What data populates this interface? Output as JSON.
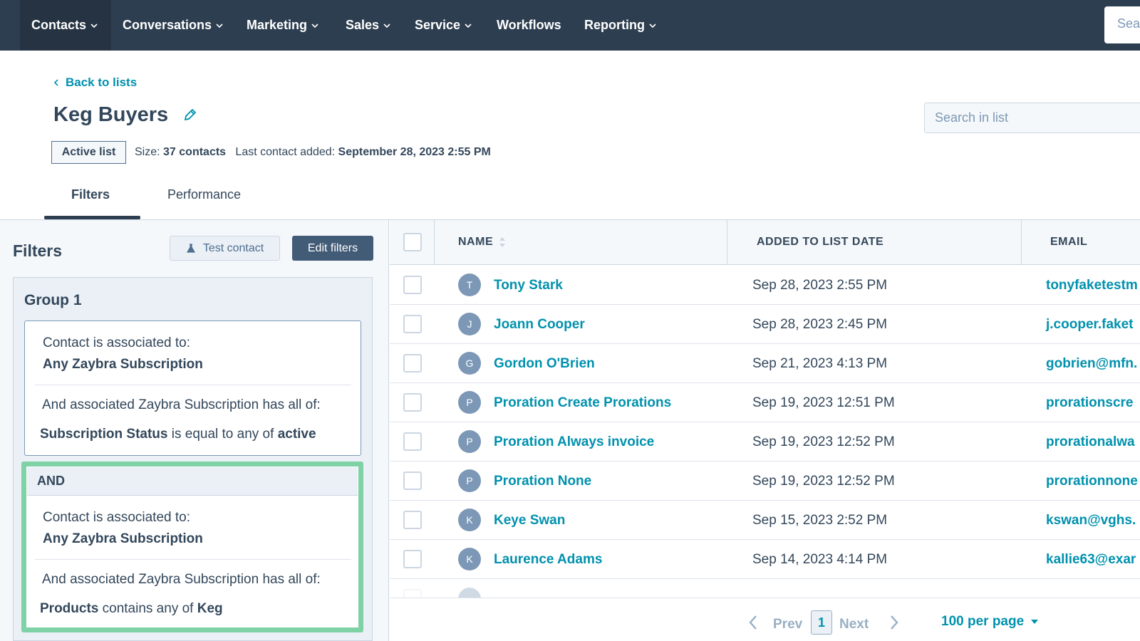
{
  "nav": {
    "items": [
      {
        "label": "Contacts",
        "has_dropdown": true,
        "active": true
      },
      {
        "label": "Conversations",
        "has_dropdown": true
      },
      {
        "label": "Marketing",
        "has_dropdown": true
      },
      {
        "label": "Sales",
        "has_dropdown": true
      },
      {
        "label": "Service",
        "has_dropdown": true
      },
      {
        "label": "Workflows",
        "has_dropdown": false
      },
      {
        "label": "Reporting",
        "has_dropdown": true
      }
    ],
    "search_placeholder": "Sea"
  },
  "header": {
    "back_label": "Back to lists",
    "title": "Keg Buyers",
    "badge": "Active list",
    "size_prefix": "Size:",
    "size_value": "37 contacts",
    "last_added_prefix": "Last contact added:",
    "last_added_value": "September 28, 2023 2:55 PM",
    "search_placeholder": "Search in list"
  },
  "tabs": [
    {
      "label": "Filters",
      "active": true
    },
    {
      "label": "Performance",
      "active": false
    }
  ],
  "filters_panel": {
    "heading": "Filters",
    "test_contact_label": "Test contact",
    "edit_filters_label": "Edit filters",
    "group_title": "Group 1",
    "and_label": "AND",
    "blocks": [
      {
        "assoc_line": "Contact is associated to:",
        "assoc_object": "Any Zaybra Subscription",
        "criteria_line": "And associated Zaybra Subscription has all of:",
        "property": "Subscription Status",
        "operator": "is equal to any of",
        "value": "active"
      },
      {
        "assoc_line": "Contact is associated to:",
        "assoc_object": "Any Zaybra Subscription",
        "criteria_line": "And associated Zaybra Subscription has all of:",
        "property": "Products",
        "operator": "contains any of",
        "value": "Keg"
      }
    ]
  },
  "table": {
    "columns": [
      "NAME",
      "ADDED TO LIST DATE",
      "EMAIL"
    ],
    "rows": [
      {
        "initial": "T",
        "name": "Tony Stark",
        "date": "Sep 28, 2023 2:55 PM",
        "email": "tonyfaketestm"
      },
      {
        "initial": "J",
        "name": "Joann Cooper",
        "date": "Sep 28, 2023 2:45 PM",
        "email": "j.cooper.faket"
      },
      {
        "initial": "G",
        "name": "Gordon O'Brien",
        "date": "Sep 21, 2023 4:13 PM",
        "email": "gobrien@mfn."
      },
      {
        "initial": "P",
        "name": "Proration Create Prorations",
        "date": "Sep 19, 2023 12:51 PM",
        "email": "prorationscre"
      },
      {
        "initial": "P",
        "name": "Proration Always invoice",
        "date": "Sep 19, 2023 12:52 PM",
        "email": "prorationalwa"
      },
      {
        "initial": "P",
        "name": "Proration None",
        "date": "Sep 19, 2023 12:52 PM",
        "email": "prorationnone"
      },
      {
        "initial": "K",
        "name": "Keye Swan",
        "date": "Sep 15, 2023 2:52 PM",
        "email": "kswan@vghs."
      },
      {
        "initial": "K",
        "name": "Laurence Adams",
        "date": "Sep 14, 2023 4:14 PM",
        "email": "kallie63@exar"
      }
    ]
  },
  "pagination": {
    "prev_label": "Prev",
    "current_page": "1",
    "next_label": "Next",
    "per_page_label": "100 per page"
  },
  "colors": {
    "nav_bg": "#2d3e50",
    "link": "#0091ae",
    "highlight": "#7fd1a6",
    "avatar": "#7c98b6",
    "primary_button": "#425b76"
  }
}
